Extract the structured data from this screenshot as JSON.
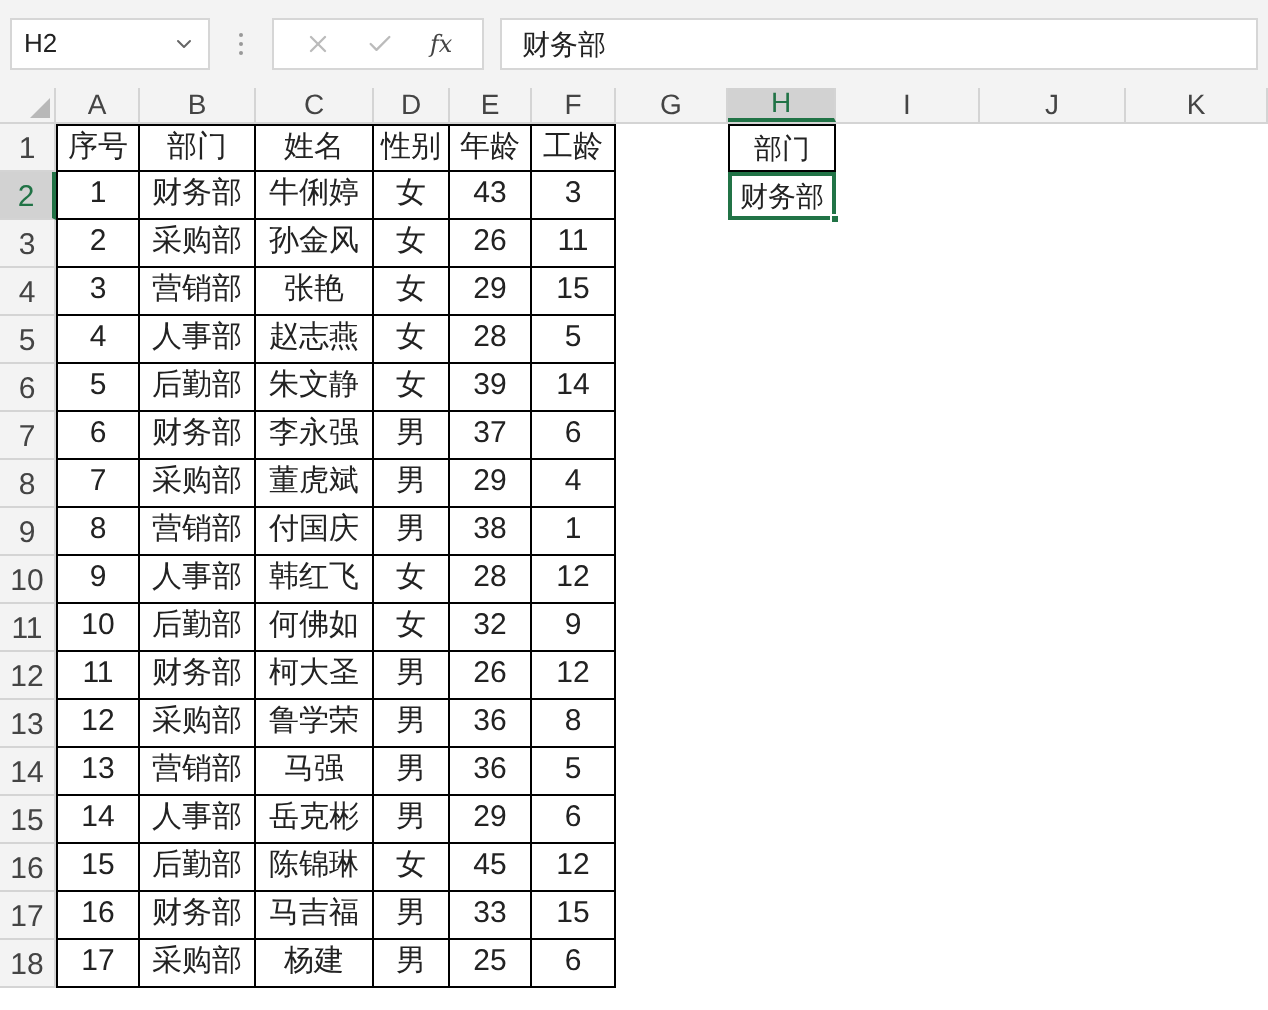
{
  "name_box": {
    "value": "H2"
  },
  "formula_bar": {
    "function_label": "fx",
    "value": "财务部"
  },
  "columns": [
    {
      "label": "A",
      "selected": false
    },
    {
      "label": "B",
      "selected": false
    },
    {
      "label": "C",
      "selected": false
    },
    {
      "label": "D",
      "selected": false
    },
    {
      "label": "E",
      "selected": false
    },
    {
      "label": "F",
      "selected": false
    },
    {
      "label": "G",
      "selected": false
    },
    {
      "label": "H",
      "selected": true
    },
    {
      "label": "I",
      "selected": false
    },
    {
      "label": "J",
      "selected": false
    },
    {
      "label": "K",
      "selected": false
    }
  ],
  "rows": [
    {
      "header": "1",
      "selected": false,
      "cells": [
        "序号",
        "部门",
        "姓名",
        "性别",
        "年龄",
        "工龄"
      ],
      "h_cell": {
        "text": "部门",
        "selected": false
      }
    },
    {
      "header": "2",
      "selected": true,
      "cells": [
        "1",
        "财务部",
        "牛俐婷",
        "女",
        "43",
        "3"
      ],
      "h_cell": {
        "text": "财务部",
        "selected": true
      }
    },
    {
      "header": "3",
      "selected": false,
      "cells": [
        "2",
        "采购部",
        "孙金风",
        "女",
        "26",
        "11"
      ]
    },
    {
      "header": "4",
      "selected": false,
      "cells": [
        "3",
        "营销部",
        "张艳",
        "女",
        "29",
        "15"
      ]
    },
    {
      "header": "5",
      "selected": false,
      "cells": [
        "4",
        "人事部",
        "赵志燕",
        "女",
        "28",
        "5"
      ]
    },
    {
      "header": "6",
      "selected": false,
      "cells": [
        "5",
        "后勤部",
        "朱文静",
        "女",
        "39",
        "14"
      ]
    },
    {
      "header": "7",
      "selected": false,
      "cells": [
        "6",
        "财务部",
        "李永强",
        "男",
        "37",
        "6"
      ]
    },
    {
      "header": "8",
      "selected": false,
      "cells": [
        "7",
        "采购部",
        "董虎斌",
        "男",
        "29",
        "4"
      ]
    },
    {
      "header": "9",
      "selected": false,
      "cells": [
        "8",
        "营销部",
        "付国庆",
        "男",
        "38",
        "1"
      ]
    },
    {
      "header": "10",
      "selected": false,
      "cells": [
        "9",
        "人事部",
        "韩红飞",
        "女",
        "28",
        "12"
      ]
    },
    {
      "header": "11",
      "selected": false,
      "cells": [
        "10",
        "后勤部",
        "何佛如",
        "女",
        "32",
        "9"
      ]
    },
    {
      "header": "12",
      "selected": false,
      "cells": [
        "11",
        "财务部",
        "柯大圣",
        "男",
        "26",
        "12"
      ]
    },
    {
      "header": "13",
      "selected": false,
      "cells": [
        "12",
        "采购部",
        "鲁学荣",
        "男",
        "36",
        "8"
      ]
    },
    {
      "header": "14",
      "selected": false,
      "cells": [
        "13",
        "营销部",
        "马强",
        "男",
        "36",
        "5"
      ]
    },
    {
      "header": "15",
      "selected": false,
      "cells": [
        "14",
        "人事部",
        "岳克彬",
        "男",
        "29",
        "6"
      ]
    },
    {
      "header": "16",
      "selected": false,
      "cells": [
        "15",
        "后勤部",
        "陈锦琳",
        "女",
        "45",
        "12"
      ]
    },
    {
      "header": "17",
      "selected": false,
      "cells": [
        "16",
        "财务部",
        "马吉福",
        "男",
        "33",
        "15"
      ]
    },
    {
      "header": "18",
      "selected": false,
      "cells": [
        "17",
        "采购部",
        "杨建",
        "男",
        "25",
        "6"
      ]
    }
  ]
}
